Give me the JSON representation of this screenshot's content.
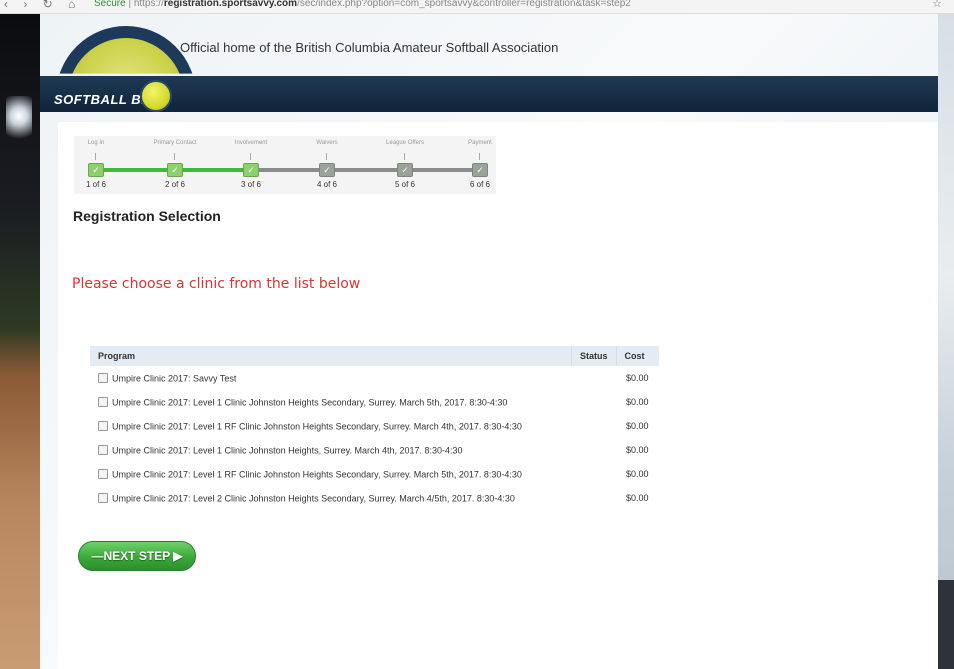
{
  "browser": {
    "nav_glyphs": "‹ › ↻ ⌂",
    "secure_label": "Secure",
    "url_host": "registration.sportsavvy.com",
    "url_rest": "/sec/index.php?option=com_sportsavvy&controller=registration&task=step2"
  },
  "site": {
    "tagline": "Official home of the British Columbia Amateur Softball Association",
    "logo_text": "SOFTBALL B.C."
  },
  "progress": {
    "steps": [
      {
        "title": "Log In",
        "count": "1 of 6",
        "done": true
      },
      {
        "title": "Primary Contact",
        "count": "2 of 6",
        "done": true
      },
      {
        "title": "Involvement",
        "count": "3 of 6",
        "done": true
      },
      {
        "title": "Waivers",
        "count": "4 of 6",
        "done": false
      },
      {
        "title": "League Offers",
        "count": "5 of 6",
        "done": false
      },
      {
        "title": "Payment",
        "count": "6 of 6",
        "done": false
      }
    ]
  },
  "page": {
    "title": "Registration Selection",
    "instructions": "Please choose a clinic from the list below"
  },
  "table": {
    "headers": {
      "program": "Program",
      "status": "Status",
      "cost": "Cost"
    },
    "rows": [
      {
        "program": "Umpire Clinic 2017: Savvy Test",
        "status": "",
        "cost": "$0.00"
      },
      {
        "program": "Umpire Clinic 2017: Level 1 Clinic Johnston Heights Secondary, Surrey. March 5th, 2017. 8:30-4:30",
        "status": "",
        "cost": "$0.00"
      },
      {
        "program": "Umpire Clinic 2017: Level 1 RF Clinic Johnston Heights Secondary, Surrey. March 4th, 2017. 8:30-4:30",
        "status": "",
        "cost": "$0.00"
      },
      {
        "program": "Umpire Clinic 2017: Level 1 Clinic Johnston Heights, Surrey. March 4th, 2017. 8:30-4:30",
        "status": "",
        "cost": "$0.00"
      },
      {
        "program": "Umpire Clinic 2017: Level 1 RF Clinic Johnston Heights Secondary, Surrey. March 5th, 2017. 8:30-4:30",
        "status": "",
        "cost": "$0.00"
      },
      {
        "program": "Umpire Clinic 2017: Level 2 Clinic Johnston Heights Secondary, Surrey. March 4/5th, 2017. 8:30-4:30",
        "status": "",
        "cost": "$0.00"
      }
    ]
  },
  "actions": {
    "next_step_label": "—NEXT STEP ▶"
  },
  "colors": {
    "instruction_red": "#d93333",
    "progress_green": "#3bbd3b",
    "navbar_navy": "#10243a",
    "button_green": "#3aa93a"
  },
  "icons": {
    "star": "bookmark-star-icon",
    "check": "check-icon",
    "checkbox": "checkbox-icon",
    "logo": "softball-logo-icon"
  }
}
